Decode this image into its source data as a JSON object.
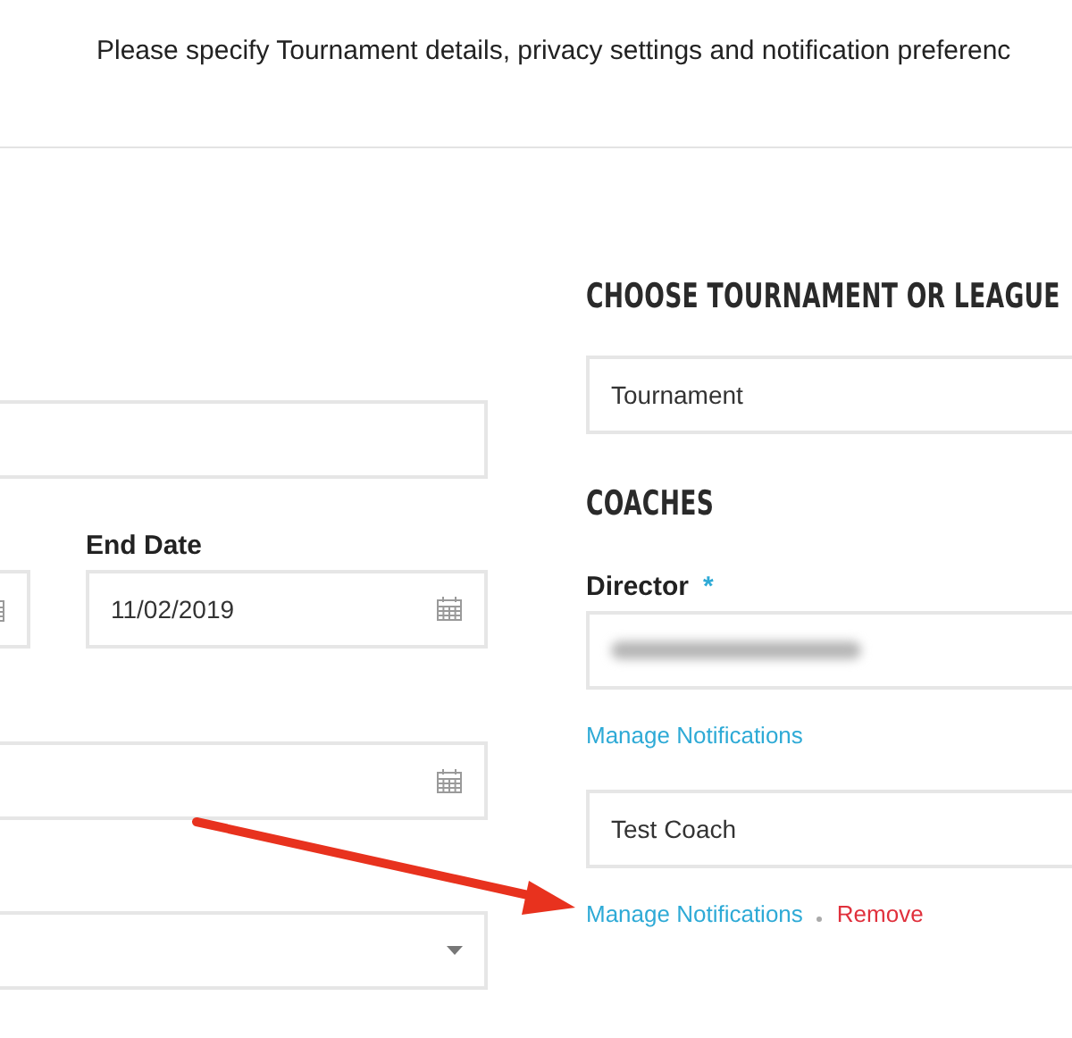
{
  "header": {
    "instruction": "Please specify Tournament details, privacy settings and notification preferenc"
  },
  "left_form": {
    "end_date": {
      "label": "End Date",
      "value": "11/02/2019"
    }
  },
  "event_type": {
    "heading": "CHOOSE TOURNAMENT OR LEAGUE",
    "value": "Tournament"
  },
  "coaches": {
    "heading": "COACHES",
    "director": {
      "label": "Director",
      "required_mark": "*",
      "redacted": true,
      "links": [
        {
          "label": "Manage Notifications",
          "kind": "manage"
        }
      ]
    },
    "others": [
      {
        "name": "Test Coach",
        "links": [
          {
            "label": "Manage Notifications",
            "kind": "manage"
          },
          {
            "label": "Remove",
            "kind": "remove"
          }
        ]
      }
    ]
  }
}
